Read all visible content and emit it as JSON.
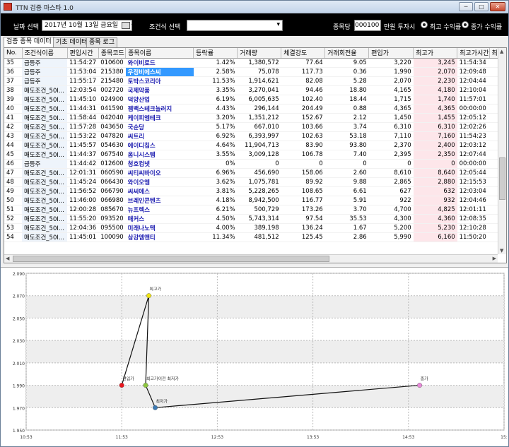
{
  "window": {
    "title": "TTN 검증 마스타 1.0",
    "btn_min": "─",
    "btn_max": "□",
    "btn_close": "✕"
  },
  "toolbar": {
    "date_label": "날짜 선택",
    "date_value": "2017년 10월 13일 금요일",
    "condition_label": "조건식 선택",
    "condition_value": "",
    "amount_label": "종목당",
    "amount_value": "000100",
    "amount_suffix": "만원 투자시",
    "radio_max_label": "최고 수익률",
    "radio_close_label": "종가 수익률"
  },
  "tabs": [
    "검증 종목 데이터",
    "기초 데이터",
    "종목 로그"
  ],
  "table": {
    "headers": [
      "No.",
      "조건식이름",
      "편입시간",
      "종목코드",
      "종목이름",
      "등락률",
      "거래량",
      "체결강도",
      "거래회전율",
      "편입가",
      "최고가",
      "최고가시간",
      "최"
    ],
    "rows": [
      [
        "35",
        "급등주",
        "11:54:27",
        "010600",
        "와이비로드",
        "1.42%",
        "1,380,572",
        "77.64",
        "9.05",
        "3,220",
        "3,245",
        "11:54:34"
      ],
      [
        "36",
        "급등주",
        "11:53:04",
        "215380",
        "우정비에스씨",
        "2.58%",
        "75,078",
        "117.73",
        "0.36",
        "1,990",
        "2,070",
        "12:09:48"
      ],
      [
        "37",
        "급등주",
        "11:55:17",
        "215480",
        "토박스코리아",
        "11.53%",
        "1,914,621",
        "82.08",
        "5.28",
        "2,070",
        "2,230",
        "12:04:44"
      ],
      [
        "38",
        "매도조건_50I...",
        "12:03:54",
        "002720",
        "국제약품",
        "3.35%",
        "3,270,041",
        "94.46",
        "18.80",
        "4,165",
        "4,180",
        "12:10:04"
      ],
      [
        "39",
        "매도조건_50I...",
        "11:45:10",
        "024900",
        "덕양산업",
        "6.19%",
        "6,005,635",
        "102.40",
        "18.44",
        "1,715",
        "1,740",
        "11:57:01"
      ],
      [
        "40",
        "매도조건_50I...",
        "11:44:31",
        "041590",
        "젬백스테크놀러지",
        "4.43%",
        "296,144",
        "204.49",
        "0.88",
        "4,365",
        "4,365",
        "00:00:00"
      ],
      [
        "41",
        "매도조건_50I...",
        "11:58:44",
        "042040",
        "케이피엠테크",
        "3.20%",
        "1,351,212",
        "152.67",
        "2.12",
        "1,450",
        "1,455",
        "12:05:12"
      ],
      [
        "42",
        "매도조건_50I...",
        "11:57:28",
        "043650",
        "국순당",
        "5.17%",
        "667,010",
        "103.66",
        "3.74",
        "6,310",
        "6,310",
        "12:02:26"
      ],
      [
        "43",
        "매도조건_50I...",
        "11:53:22",
        "047820",
        "씨트리",
        "6.92%",
        "6,393,997",
        "102.63",
        "53.18",
        "7,110",
        "7,160",
        "11:54:23"
      ],
      [
        "44",
        "매도조건_50I...",
        "11:45:57",
        "054630",
        "에이디칩스",
        "4.64%",
        "11,904,713",
        "83.90",
        "93.80",
        "2,370",
        "2,400",
        "12:03:12"
      ],
      [
        "45",
        "매도조건_50I...",
        "11:44:37",
        "067540",
        "옴니시스템",
        "3.55%",
        "3,009,128",
        "106.78",
        "7.40",
        "2,395",
        "2,350",
        "12:07:44"
      ],
      [
        "46",
        "급등주",
        "11:44:42",
        "012600",
        "청호컴넷",
        "0%",
        "0",
        "0",
        "0",
        "0",
        "0",
        "00:00:00"
      ],
      [
        "47",
        "매도조건_50I...",
        "12:01:31",
        "060590",
        "씨티씨바이오",
        "6.96%",
        "456,690",
        "158.06",
        "2.60",
        "8,610",
        "8,640",
        "12:05:44"
      ],
      [
        "48",
        "매도조건_50I...",
        "11:45:24",
        "066430",
        "와이오엠",
        "3.62%",
        "1,075,781",
        "89.92",
        "9.88",
        "2,865",
        "2,880",
        "12:15:53"
      ],
      [
        "49",
        "매도조건_50I...",
        "11:56:52",
        "066790",
        "씨씨에스",
        "3.81%",
        "5,228,265",
        "108.65",
        "6.61",
        "627",
        "632",
        "12:03:04"
      ],
      [
        "50",
        "매도조건_50I...",
        "11:46:00",
        "066980",
        "브레인콘텐츠",
        "4.18%",
        "8,942,500",
        "116.77",
        "5.91",
        "922",
        "932",
        "12:04:46"
      ],
      [
        "51",
        "매도조건_50I...",
        "12:00:28",
        "085670",
        "뉴프렉스",
        "6.21%",
        "500,729",
        "173.26",
        "3.70",
        "4,700",
        "4,825",
        "12:01:11"
      ],
      [
        "52",
        "매도조건_50I...",
        "11:55:20",
        "093520",
        "매커스",
        "4.50%",
        "5,743,314",
        "97.54",
        "35.53",
        "4,300",
        "4,360",
        "12:08:35"
      ],
      [
        "53",
        "매도조건_50I...",
        "12:04:36",
        "095500",
        "미래나노텍",
        "4.00%",
        "389,198",
        "136.24",
        "1.67",
        "5,200",
        "5,230",
        "12:10:28"
      ],
      [
        "54",
        "매도조건_50I...",
        "11:45:01",
        "100090",
        "삼강엠앤티",
        "11.34%",
        "481,512",
        "125.45",
        "2.86",
        "5,990",
        "6,160",
        "11:50:20"
      ]
    ]
  },
  "chart_data": {
    "type": "scatter",
    "title": "",
    "x_ticks": [
      "10:53",
      "11:53",
      "12:53",
      "13:53",
      "14:53",
      "15:"
    ],
    "y_ticks": [
      "1.950",
      "1.970",
      "1.990",
      "2.010",
      "2.030",
      "2.050",
      "2.070",
      "2.090"
    ],
    "xlim_minutes": [
      653,
      953
    ],
    "ylim": [
      1950,
      2090
    ],
    "points": [
      {
        "label": "편입가",
        "time_min": 713,
        "value": 1990,
        "color": "#e8181f"
      },
      {
        "label": "최고가",
        "time_min": 730,
        "value": 2070,
        "color": "#f0e412"
      },
      {
        "label": "최고가이전 최저가",
        "time_min": 728,
        "value": 1990,
        "color": "#8dc63f"
      },
      {
        "label": "최저가",
        "time_min": 734,
        "value": 1970,
        "color": "#3d7ab3"
      },
      {
        "label": "종가",
        "time_min": 900,
        "value": 1990,
        "color": "#e88ad9"
      }
    ],
    "line_order": [
      0,
      1,
      2,
      3,
      4
    ]
  }
}
